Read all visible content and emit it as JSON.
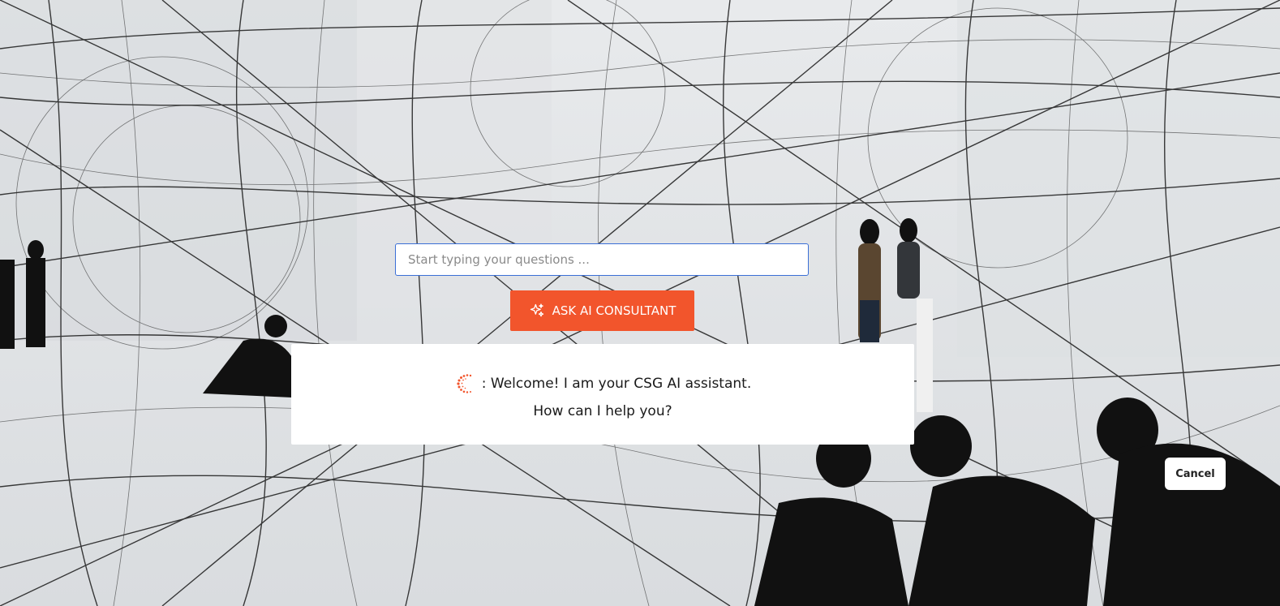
{
  "search": {
    "placeholder": "Start typing your questions ...",
    "value": ""
  },
  "ask_button": {
    "label": "ASK AI CONSULTANT",
    "icon": "sparkle-icon"
  },
  "welcome": {
    "line1": ": Welcome! I am your CSG AI assistant.",
    "line2": "How can I help you?",
    "icon": "ai-assistant-icon"
  },
  "cancel_button": {
    "label": "Cancel"
  },
  "colors": {
    "accent": "#f2552c",
    "input_border": "#3b6fd6",
    "card_bg": "#ffffff"
  }
}
